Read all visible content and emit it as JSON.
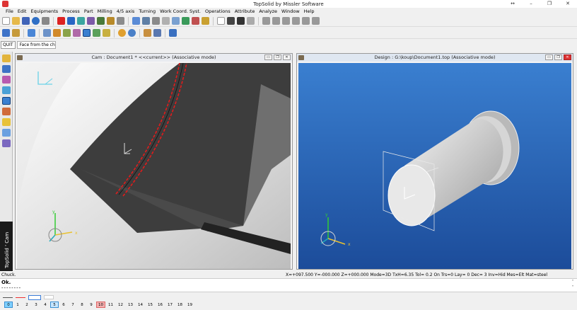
{
  "window": {
    "title": "TopSolid by Missler Software",
    "controls": [
      "↔",
      "–",
      "❐",
      "✕"
    ]
  },
  "menu": [
    "File",
    "Edit",
    "Equipments",
    "Process",
    "Part",
    "Milling",
    "4/5 axis",
    "Turning",
    "Work Coord. Syst.",
    "Operations",
    "Attribute",
    "Analyze",
    "Window",
    "Help"
  ],
  "command": {
    "quit_label": "QUIT",
    "prompt": "Face from the chuck"
  },
  "sidebar": {
    "brand": "TopSolid ' Cam",
    "icons": [
      "pencil-icon",
      "solid-icon",
      "surface-icon",
      "machining-icon",
      "turning-icon",
      "tool-icon",
      "coolant-icon",
      "simulation-icon",
      "postprocessor-icon"
    ]
  },
  "panels": {
    "cam": {
      "title": "Cam : Document1 *  <<current>> (Associative mode)",
      "buttons": [
        "▭",
        "❐",
        "✕"
      ]
    },
    "design": {
      "title": "Design : G:\\koup\\Document1.top (Associative mode)",
      "buttons": [
        "▭",
        "❐",
        "✕"
      ]
    }
  },
  "triad": {
    "x": "x",
    "y": "y",
    "z": "z"
  },
  "status": {
    "left": "Chuck.",
    "right": "X=+097.500  Y=-000.000  Z=+000.000  Mode=3D  TxH=6.35   Tol=  0.2    On  Trs=0   Lay=  0   Dec= 3    Inv=Hid  Mes=Elt  Mat=steel"
  },
  "messages": {
    "ok": "Ok.",
    "dashes": "--------",
    "scroll_up": "˄",
    "scroll_down": "˅"
  },
  "layers": [
    "0",
    "1",
    "2",
    "3",
    "4",
    "5",
    "6",
    "7",
    "8",
    "9",
    "10",
    "11",
    "12",
    "13",
    "14",
    "15",
    "16",
    "17",
    "18",
    "19"
  ],
  "colors": {
    "design_bg_top": "#3a7fd0",
    "design_bg_bottom": "#1c4c9a",
    "cam_face": "#3d3d3d",
    "toolpath": "#e31b1b"
  }
}
